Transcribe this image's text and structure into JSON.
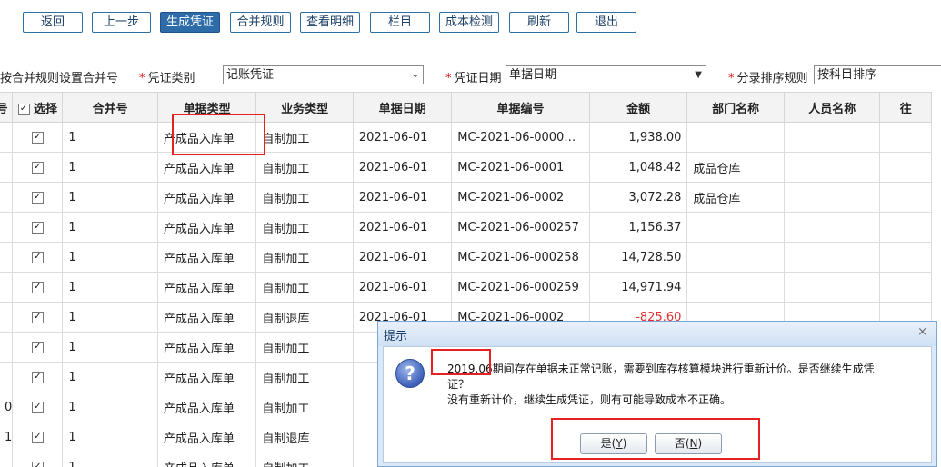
{
  "toolbar": {
    "back": "返回",
    "prev_step": "上一步",
    "generate_voucher": "生成凭证",
    "merge_rules": "合并规则",
    "view_detail": "查看明细",
    "columns": "栏目",
    "cost_check": "成本检测",
    "refresh": "刷新",
    "exit": "退出"
  },
  "filters": {
    "merge_rule_text": "按合并规则设置合并号",
    "voucher_type_label": "凭证类别",
    "voucher_type_value": "记账凭证",
    "voucher_date_label": "凭证日期",
    "voucher_date_value": "单据日期",
    "sort_rule_label": "分录排序规则",
    "sort_rule_value": "按科目排序"
  },
  "table": {
    "headers": {
      "seq": "号",
      "select": "选择",
      "merge_no": "合并号",
      "doc_type": "单据类型",
      "biz_type": "业务类型",
      "doc_date": "单据日期",
      "doc_no": "单据编号",
      "amount": "金额",
      "dept": "部门名称",
      "person": "人员名称",
      "extra": "往"
    },
    "rows": [
      {
        "seq": "",
        "merge": "1",
        "doc_type": "产成品入库单",
        "biz_type": "自制加工",
        "date": "2021-06-01",
        "doc_no": "MC-2021-06-0000…",
        "amount": "1,938.00",
        "dept": "",
        "person": ""
      },
      {
        "seq": "",
        "merge": "1",
        "doc_type": "产成品入库单",
        "biz_type": "自制加工",
        "date": "2021-06-01",
        "doc_no": "MC-2021-06-0001",
        "amount": "1,048.42",
        "dept": "成品仓库",
        "person": ""
      },
      {
        "seq": "",
        "merge": "1",
        "doc_type": "产成品入库单",
        "biz_type": "自制加工",
        "date": "2021-06-01",
        "doc_no": "MC-2021-06-0002",
        "amount": "3,072.28",
        "dept": "成品仓库",
        "person": ""
      },
      {
        "seq": "",
        "merge": "1",
        "doc_type": "产成品入库单",
        "biz_type": "自制加工",
        "date": "2021-06-01",
        "doc_no": "MC-2021-06-000257",
        "amount": "1,156.37",
        "dept": "",
        "person": ""
      },
      {
        "seq": "",
        "merge": "1",
        "doc_type": "产成品入库单",
        "biz_type": "自制加工",
        "date": "2021-06-01",
        "doc_no": "MC-2021-06-000258",
        "amount": "14,728.50",
        "dept": "",
        "person": ""
      },
      {
        "seq": "",
        "merge": "1",
        "doc_type": "产成品入库单",
        "biz_type": "自制加工",
        "date": "2021-06-01",
        "doc_no": "MC-2021-06-000259",
        "amount": "14,971.94",
        "dept": "",
        "person": ""
      },
      {
        "seq": "",
        "merge": "1",
        "doc_type": "产成品入库单",
        "biz_type": "自制退库",
        "date": "2021-06-01",
        "doc_no": "MC-2021-06-0002",
        "amount": "-825.60",
        "dept": "",
        "person": ""
      },
      {
        "seq": "",
        "merge": "1",
        "doc_type": "产成品入库单",
        "biz_type": "自制加工",
        "date": "",
        "doc_no": "",
        "amount": "",
        "dept": "",
        "person": ""
      },
      {
        "seq": "",
        "merge": "1",
        "doc_type": "产成品入库单",
        "biz_type": "自制加工",
        "date": "",
        "doc_no": "",
        "amount": "",
        "dept": "",
        "person": ""
      },
      {
        "seq": "0",
        "merge": "1",
        "doc_type": "产成品入库单",
        "biz_type": "自制加工",
        "date": "",
        "doc_no": "",
        "amount": "",
        "dept": "",
        "person": ""
      },
      {
        "seq": "1",
        "merge": "1",
        "doc_type": "产成品入库单",
        "biz_type": "自制退库",
        "date": "",
        "doc_no": "",
        "amount": "",
        "dept": "",
        "person": ""
      },
      {
        "seq": "",
        "merge": "1",
        "doc_type": "产成品入库单",
        "biz_type": "自制加工",
        "date": "",
        "doc_no": "",
        "amount": "",
        "dept": "",
        "person": ""
      }
    ]
  },
  "dialog": {
    "title": "提示",
    "close": "×",
    "message_line1": "2019.06期间存在单据未正常记账，需要到库存核算模块进行重新计价。是否继续生成凭",
    "message_line2": "证？",
    "message_line3": "没有重新计价，继续生成凭证，则有可能导致成本不正确。",
    "yes_text": "是(",
    "yes_key": "Y",
    "yes_end": ")",
    "no_text": "否(",
    "no_key": "N",
    "no_end": ")"
  },
  "colors": {
    "accent": "#2d6ca8",
    "highlight": "#e52121",
    "negative": "#e03030"
  }
}
